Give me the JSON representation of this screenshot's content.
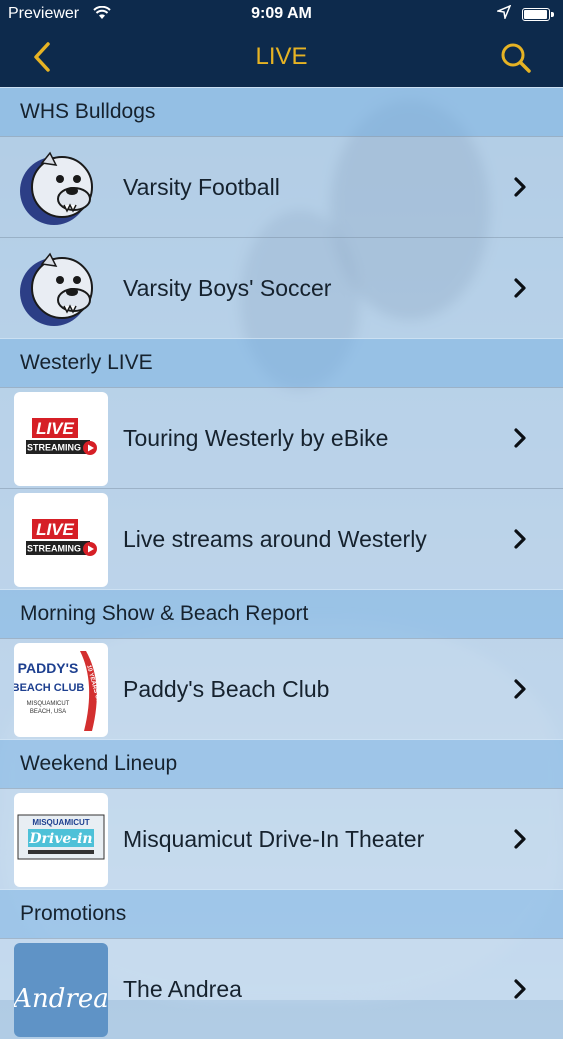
{
  "status_bar": {
    "carrier": "Previewer",
    "time": "9:09 AM",
    "battery_fraction": 0.9
  },
  "nav": {
    "title": "LIVE",
    "back_icon": "chevron-left-icon",
    "search_icon": "search-icon"
  },
  "sections": [
    {
      "title": "WHS Bulldogs",
      "items": [
        {
          "label": "Varsity Football",
          "thumb": "bulldog"
        },
        {
          "label": "Varsity Boys' Soccer",
          "thumb": "bulldog"
        }
      ]
    },
    {
      "title": "Westerly LIVE",
      "items": [
        {
          "label": "Touring Westerly by eBike",
          "thumb": "live-streaming"
        },
        {
          "label": "Live streams around Westerly",
          "thumb": "live-streaming"
        }
      ]
    },
    {
      "title": "Morning Show & Beach Report",
      "items": [
        {
          "label": "Paddy's Beach Club",
          "thumb": "paddys"
        }
      ]
    },
    {
      "title": "Weekend Lineup",
      "items": [
        {
          "label": "Misquamicut Drive-In Theater",
          "thumb": "drive-in"
        }
      ]
    },
    {
      "title": "Promotions",
      "items": [
        {
          "label": "The Andrea",
          "thumb": "andrea"
        }
      ]
    }
  ],
  "logo_text": {
    "live": "LIVE",
    "streaming": "STREAMING",
    "paddys": "PADDY'S",
    "beach_club": "BEACH CLUB",
    "misquamicut": "MISQUAMICUT",
    "beach_usa": "BEACH, USA",
    "years_of_fun": "10 YEARS OF FUN",
    "drive_in": "Drive-in",
    "andrea": "Andrea"
  }
}
